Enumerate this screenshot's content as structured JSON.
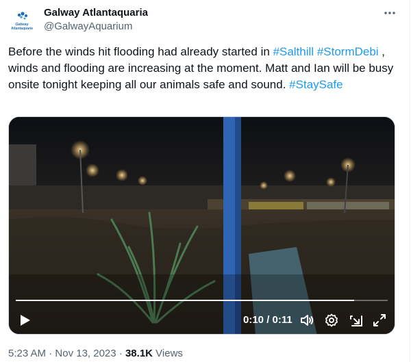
{
  "account": {
    "name": "Galway Atlantaquaria",
    "handle": "@GalwayAquarium",
    "avatar_text": "Galway Atlantaquaria",
    "avatar_color": "#1d6fb8"
  },
  "more_icon": "more-dots-icon",
  "tweet": {
    "segments": [
      {
        "text": "Before the winds hit flooding had already started in ",
        "type": "text"
      },
      {
        "text": "#Salthill",
        "type": "hashtag"
      },
      {
        "text": " ",
        "type": "text"
      },
      {
        "text": "#StormDebi",
        "type": "hashtag"
      },
      {
        "text": " , winds and flooding are increasing at the moment. Matt and Ian will be busy onsite tonight keeping all our animals safe and sound. ",
        "type": "text"
      },
      {
        "text": "#StaySafe",
        "type": "hashtag"
      }
    ],
    "hashtag_color": "#1d9bf0"
  },
  "video": {
    "time_display": "0:10 / 0:11",
    "progress": 0.91,
    "controls": [
      "play-icon",
      "volume-icon",
      "settings-gear-icon",
      "pop-out-icon",
      "fullscreen-icon"
    ]
  },
  "meta": {
    "time": "5:23 AM",
    "separator": " · ",
    "date": "Nov 13, 2023",
    "views_count": "38.1K",
    "views_label": " Views"
  }
}
